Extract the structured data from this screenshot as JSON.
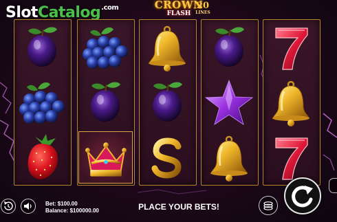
{
  "watermark": {
    "part1": "Slot",
    "part2": "Catalog",
    "part3": ".com"
  },
  "game_logo": {
    "line1": "CROWN",
    "line2": "FLASH",
    "lines_number": "20",
    "lines_label": "LINES"
  },
  "reels": [
    [
      "plum-icon",
      "blueberries-icon",
      "strawberry-icon"
    ],
    [
      "blueberries-icon",
      "plum-icon",
      "crown-icon"
    ],
    [
      "bell-icon",
      "plum-icon",
      "dollar-icon"
    ],
    [
      "plum-icon",
      "star-icon",
      "bell-icon"
    ],
    [
      "seven-icon",
      "bell-icon",
      "seven-icon"
    ]
  ],
  "bottom_bar": {
    "bet_label": "Bet: $100.00",
    "balance_label": "Balance: $100000.00",
    "status": "PLACE YOUR BETS!"
  },
  "colors": {
    "reel_border": "#b8862a",
    "gold": "#f7c843",
    "watermark_green": "#49c04a"
  }
}
